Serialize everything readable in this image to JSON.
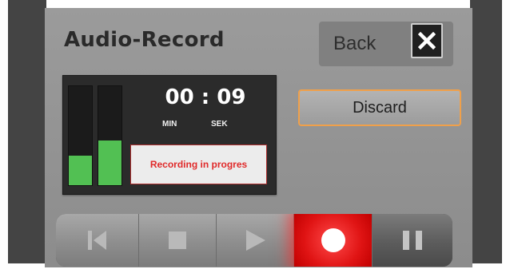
{
  "screen": {
    "title": "Audio-Record",
    "back_label": "Back",
    "close_icon": "close-icon"
  },
  "recorder": {
    "minutes": "00",
    "separator": ":",
    "seconds": "09",
    "minutes_unit": "MIN",
    "seconds_unit": "SEK",
    "status": "Recording in progres",
    "level_left": 0.3,
    "level_right": 0.45,
    "meter_color": "#52c053",
    "status_color": "#e02a2a"
  },
  "actions": {
    "discard_label": "Discard",
    "discard_border_color": "#f0a04a"
  },
  "transport": {
    "buttons": [
      {
        "icon": "skip-to-start-icon",
        "active": false
      },
      {
        "icon": "stop-icon",
        "active": false
      },
      {
        "icon": "play-icon",
        "active": false
      },
      {
        "icon": "record-icon",
        "active": true
      },
      {
        "icon": "pause-icon",
        "active": false
      }
    ],
    "record_color": "#e01414"
  }
}
